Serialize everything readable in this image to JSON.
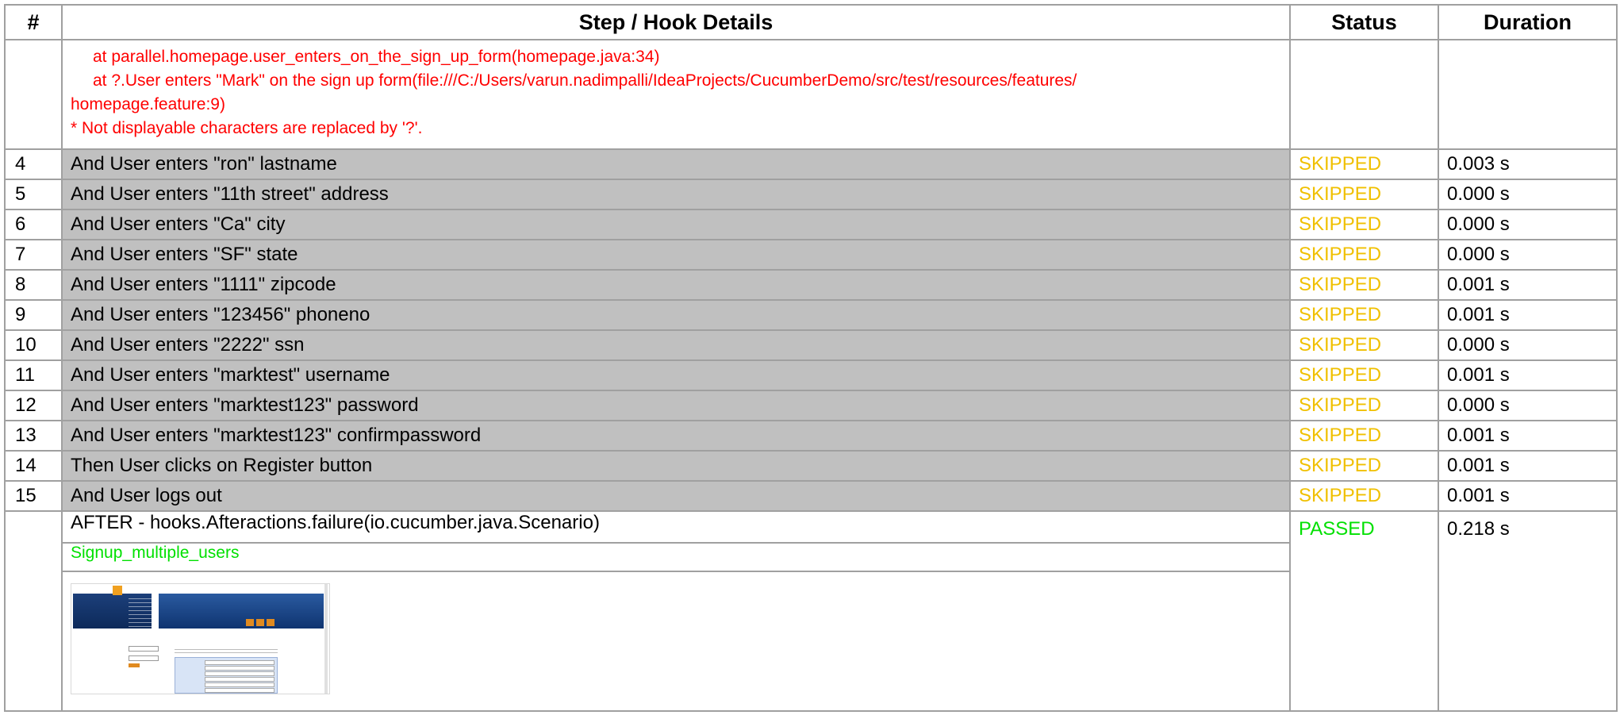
{
  "headers": {
    "num": "#",
    "details": "Step / Hook Details",
    "status": "Status",
    "duration": "Duration"
  },
  "error": {
    "line1": "at parallel.homepage.user_enters_on_the_sign_up_form(homepage.java:34)",
    "line2": "at ?.User enters \"Mark\" on the sign up form(file:///C:/Users/varun.nadimpalli/IdeaProjects/CucumberDemo/src/test/resources/features/",
    "line3": "homepage.feature:9)",
    "note": "* Not displayable characters are replaced by '?'."
  },
  "steps": [
    {
      "num": "4",
      "text": "And User enters \"ron\" lastname",
      "status": "SKIPPED",
      "duration": "0.003 s"
    },
    {
      "num": "5",
      "text": "And User enters \"11th street\" address",
      "status": "SKIPPED",
      "duration": "0.000 s"
    },
    {
      "num": "6",
      "text": "And User enters \"Ca\" city",
      "status": "SKIPPED",
      "duration": "0.000 s"
    },
    {
      "num": "7",
      "text": "And User enters \"SF\" state",
      "status": "SKIPPED",
      "duration": "0.000 s"
    },
    {
      "num": "8",
      "text": "And User enters \"1111\" zipcode",
      "status": "SKIPPED",
      "duration": "0.001 s"
    },
    {
      "num": "9",
      "text": "And User enters \"123456\" phoneno",
      "status": "SKIPPED",
      "duration": "0.001 s"
    },
    {
      "num": "10",
      "text": "And User enters \"2222\" ssn",
      "status": "SKIPPED",
      "duration": "0.000 s"
    },
    {
      "num": "11",
      "text": "And User enters \"marktest\" username",
      "status": "SKIPPED",
      "duration": "0.001 s"
    },
    {
      "num": "12",
      "text": "And User enters \"marktest123\" password",
      "status": "SKIPPED",
      "duration": "0.000 s"
    },
    {
      "num": "13",
      "text": "And User enters \"marktest123\" confirmpassword",
      "status": "SKIPPED",
      "duration": "0.001 s"
    },
    {
      "num": "14",
      "text": "Then User clicks on Register button",
      "status": "SKIPPED",
      "duration": "0.001 s"
    },
    {
      "num": "15",
      "text": "And User logs out",
      "status": "SKIPPED",
      "duration": "0.001 s"
    }
  ],
  "after": {
    "text": "AFTER - hooks.Afteractions.failure(io.cucumber.java.Scenario)",
    "status": "PASSED",
    "duration": "0.218 s",
    "tag": "Signup_multiple_users",
    "screenshot_icon": "screenshot-thumbnail"
  },
  "colors": {
    "error": "#ff0000",
    "skipped": "#f0c000",
    "passed": "#00e000",
    "step_bg": "#c0c0c0",
    "border": "#a0a0a0"
  }
}
